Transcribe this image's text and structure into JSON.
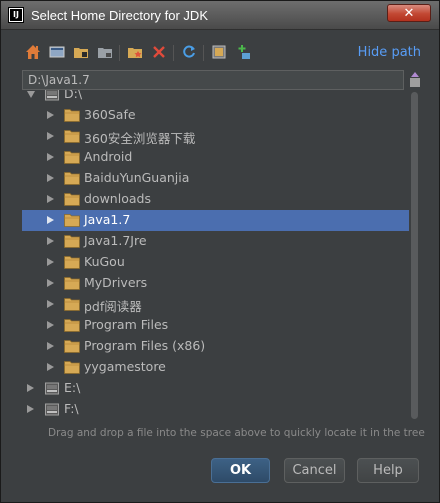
{
  "window": {
    "title": "Select Home Directory for JDK",
    "close_glyph": "✕"
  },
  "toolbar": {
    "buttons": [
      "home-icon",
      "desktop-icon",
      "project-icon",
      "module-icon",
      "new-folder-icon",
      "delete-icon",
      "refresh-icon",
      "show-hidden-icon",
      "new-path-icon"
    ],
    "hide_path_label": "Hide path"
  },
  "path_field": {
    "value": "D:\\Java1.7"
  },
  "tree": {
    "root": "D:\\",
    "items": [
      {
        "label": "360Safe"
      },
      {
        "label": "360安全浏览器下载"
      },
      {
        "label": "Android"
      },
      {
        "label": "BaiduYunGuanjia"
      },
      {
        "label": "downloads"
      },
      {
        "label": "Java1.7",
        "selected": true
      },
      {
        "label": "Java1.7Jre"
      },
      {
        "label": "KuGou"
      },
      {
        "label": "MyDrivers"
      },
      {
        "label": "pdf阅读器"
      },
      {
        "label": "Program Files"
      },
      {
        "label": "Program Files (x86)"
      },
      {
        "label": "yygamestore"
      }
    ],
    "other_drives": [
      "E:\\",
      "F:\\"
    ]
  },
  "hint": "Drag and drop a file into the space above to quickly locate it in the tree",
  "buttons": {
    "ok": "OK",
    "cancel": "Cancel",
    "help": "Help"
  },
  "colors": {
    "background": "#3c3f41",
    "selection": "#4b6eaf",
    "link": "#589df6",
    "folder": "#d6a955"
  }
}
